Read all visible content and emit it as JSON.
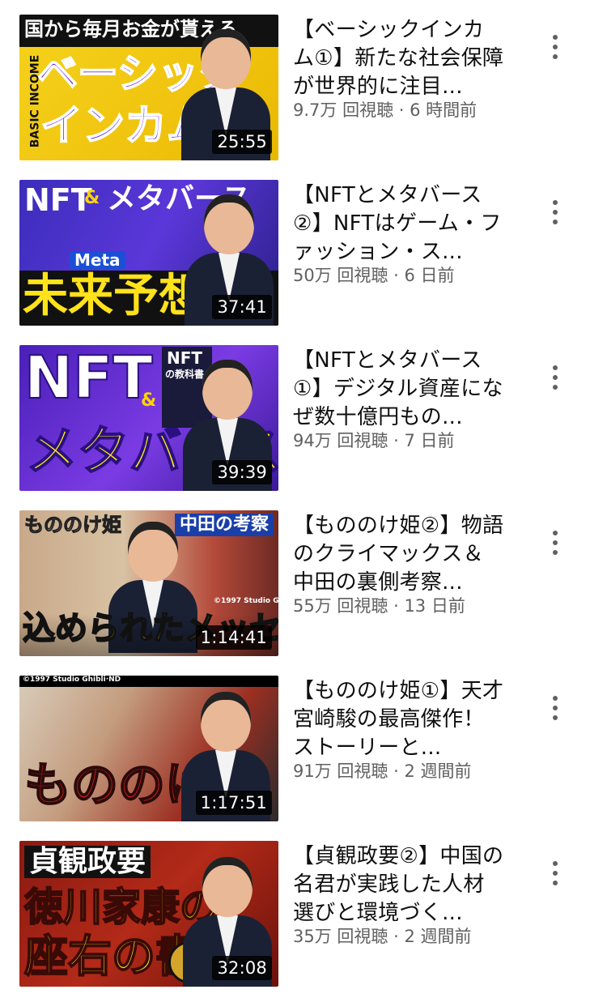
{
  "videos": [
    {
      "title": "【ベーシックインカム①】新たな社会保障が世界的に注目...",
      "views": "9.7万 回視聴",
      "age": "6 時間前",
      "duration": "25:55",
      "thumb_text": [
        "国から毎月お金が貰える",
        "ベーシック",
        "インカム",
        "BASIC INCOME"
      ]
    },
    {
      "title": "【NFTとメタバース②】NFTはゲーム・ファッション・ス...",
      "views": "50万 回視聴",
      "age": "6 日前",
      "duration": "37:41",
      "thumb_text": [
        "NFT",
        "&",
        "メタバース",
        "Meta",
        "未来予想"
      ]
    },
    {
      "title": "【NFTとメタバース①】デジタル資産になぜ数十億円もの...",
      "views": "94万 回視聴",
      "age": "7 日前",
      "duration": "39:39",
      "thumb_text": [
        "NFT",
        "&",
        "メタバース",
        "NFT",
        "の教科書"
      ]
    },
    {
      "title": "【もののけ姫②】物語のクライマックス＆中田の裏側考察...",
      "views": "55万 回視聴",
      "age": "13 日前",
      "duration": "1:14:41",
      "thumb_text": [
        "もののけ姫",
        "中田の考察",
        "込められたメッセージ",
        "©1997 Studio Ghibli·ND"
      ]
    },
    {
      "title": "【もののけ姫①】天才宮崎駿の最高傑作！ストーリーと...",
      "views": "91万 回視聴",
      "age": "2 週間前",
      "duration": "1:17:51",
      "thumb_text": [
        "©1997 Studio Ghibli·ND",
        "もののけ姫"
      ]
    },
    {
      "title": "【貞観政要②】中国の名君が実践した人材選びと環境づく...",
      "views": "35万 回視聴",
      "age": "2 週間前",
      "duration": "32:08",
      "thumb_text": [
        "貞観政要",
        "徳川家康の",
        "座右の書"
      ]
    }
  ],
  "meta_separator": " · ",
  "colors": {
    "text_primary": "#0f0f0f",
    "text_secondary": "#606060",
    "duration_badge": "#000000"
  },
  "icons": {
    "more": "more-vert-icon"
  }
}
